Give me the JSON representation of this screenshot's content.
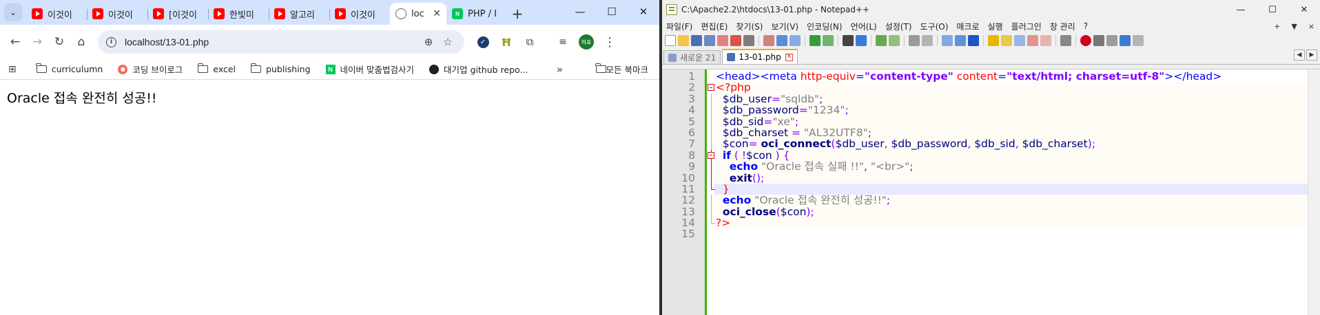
{
  "browser": {
    "tabs": [
      {
        "title": "이것이",
        "icon": "youtube-icon",
        "active": false
      },
      {
        "title": "이것이",
        "icon": "youtube-icon",
        "active": false
      },
      {
        "title": "[이것이",
        "icon": "youtube-icon",
        "active": false
      },
      {
        "title": "한빛미",
        "icon": "youtube-icon",
        "active": false
      },
      {
        "title": "알고리",
        "icon": "youtube-icon",
        "active": false
      },
      {
        "title": "이것이",
        "icon": "youtube-icon",
        "active": false
      },
      {
        "title": "loc",
        "icon": "globe-icon",
        "active": true
      },
      {
        "title": "PHP / I",
        "icon": "naver-icon",
        "active": false
      }
    ],
    "url": "localhost/13-01.php",
    "avatar_text": "의표",
    "bookmarks": [
      {
        "label": "curriculumn",
        "icon": "folder-icon"
      },
      {
        "label": "코딩 브이로그",
        "icon": "coding-vlog-icon"
      },
      {
        "label": "excel",
        "icon": "folder-icon"
      },
      {
        "label": "publishing",
        "icon": "folder-icon"
      },
      {
        "label": "네이버 맞춤법검사기",
        "icon": "naver-icon"
      },
      {
        "label": "대기업 github repo...",
        "icon": "github-icon"
      }
    ],
    "bookmarks_more": "»",
    "all_bookmarks": "모든 북마크",
    "page_text": "Oracle 접속 완전히 성공!!"
  },
  "notepad": {
    "title": "C:\\Apache2.2\\htdocs\\13-01.php - Notepad++",
    "menu": [
      "파일(F)",
      "편집(E)",
      "찾기(S)",
      "보기(V)",
      "인코딩(N)",
      "언어(L)",
      "설정(T)",
      "도구(O)",
      "매크로",
      "실행",
      "플러그인",
      "창 관리",
      "?"
    ],
    "menu_right": [
      "+",
      "▼",
      "×"
    ],
    "tabs": [
      {
        "label": "새로운 21",
        "active": false
      },
      {
        "label": "13-01.php",
        "active": true
      }
    ],
    "line_numbers": [
      "1",
      "2",
      "3",
      "4",
      "5",
      "6",
      "7",
      "8",
      "9",
      "10",
      "11",
      "12",
      "13",
      "14",
      "15"
    ],
    "code": {
      "l1": {
        "a": "<head><meta ",
        "b": "http-equiv",
        "c": "=",
        "d": "\"content-type\"",
        "e": " ",
        "f": "content",
        "g": "=",
        "h": "\"text/html; charset=utf-8\"",
        "i": "></head>"
      },
      "l2": {
        "a": "<?php"
      },
      "l3": {
        "a": "$db_user",
        "b": "=",
        "c": "\"sqldb\"",
        "d": ";"
      },
      "l4": {
        "a": "$db_password",
        "b": "=",
        "c": "\"1234\"",
        "d": ";"
      },
      "l5": {
        "a": "$db_sid",
        "b": "=",
        "c": "\"xe\"",
        "d": ";"
      },
      "l6": {
        "a": "$db_charset",
        "b": " = ",
        "c": "\"AL32UTF8\"",
        "d": ";"
      },
      "l7": {
        "a": "$con",
        "b": "= ",
        "c": "oci_connect",
        "d": "(",
        "e": "$db_user",
        "f": ", ",
        "g": "$db_password",
        "h": ", ",
        "i": "$db_sid",
        "j": ", ",
        "k": "$db_charset",
        "l": ");"
      },
      "l8": {
        "a": "if",
        "b": " ( !",
        "c": "$con",
        "d": " ) {"
      },
      "l9": {
        "a": "echo",
        "b": " ",
        "c": "\"Oracle 접속 실패 !!\"",
        "d": ", ",
        "e": "\"<br>\"",
        "f": ";"
      },
      "l10": {
        "a": "exit",
        "b": "();"
      },
      "l11": {
        "a": "}"
      },
      "l12": {
        "a": "echo",
        "b": " ",
        "c": "\"Oracle 접속 완전히 성공!!\"",
        "d": ";"
      },
      "l13": {
        "a": "oci_close",
        "b": "(",
        "c": "$con",
        "d": ");"
      },
      "l14": {
        "a": "?>"
      }
    }
  },
  "colors": {
    "chrome_tabstrip": "#d3e3fd",
    "npp_keyword": "#0000ff",
    "npp_php_tag": "#ff0000",
    "npp_string": "#808080",
    "npp_value": "#8000ff",
    "npp_change_bar": "#3bb300"
  }
}
